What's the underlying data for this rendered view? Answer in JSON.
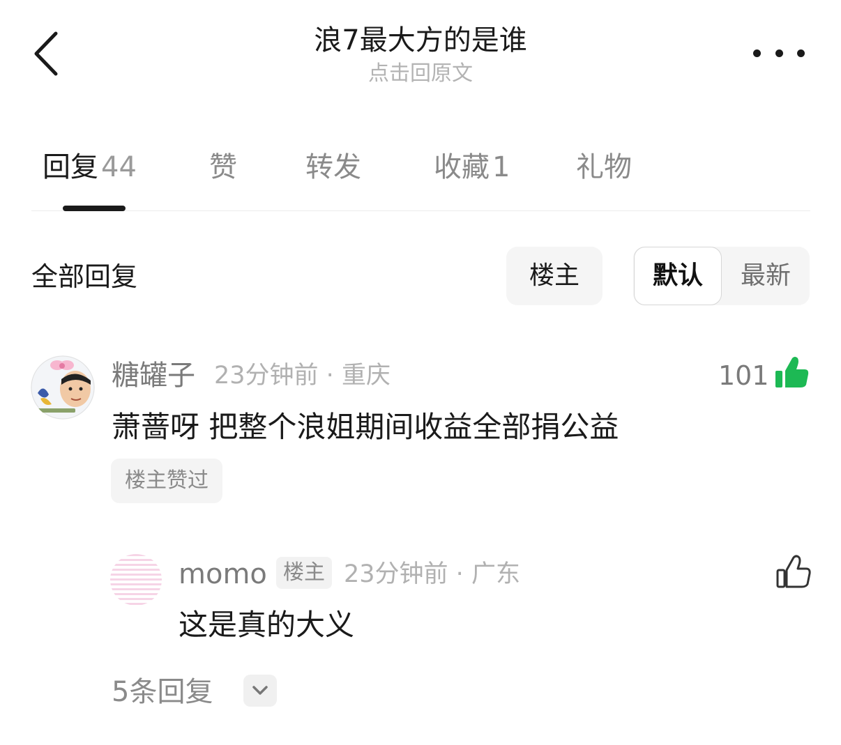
{
  "header": {
    "title": "浪7最大方的是谁",
    "subtitle": "点击回原文",
    "back_icon": "chevron-left-icon",
    "more_icon": "more-horizontal-icon"
  },
  "tabs": [
    {
      "label": "回复",
      "count": "44"
    },
    {
      "label": "赞",
      "count": ""
    },
    {
      "label": "转发",
      "count": ""
    },
    {
      "label": "收藏",
      "count": "1"
    },
    {
      "label": "礼物",
      "count": ""
    }
  ],
  "filter": {
    "all_replies_label": "全部回复",
    "op_only_label": "楼主",
    "sort_default_label": "默认",
    "sort_latest_label": "最新"
  },
  "comments": [
    {
      "username": "糖罐子",
      "time": "23分钟前",
      "location": "重庆",
      "like_count": "101",
      "liked": true,
      "content": "萧蔷呀 把整个浪姐期间收益全部捐公益",
      "op_liked_label": "楼主赞过"
    },
    {
      "username": "momo",
      "op_badge": "楼主",
      "time": "23分钟前",
      "location": "广东",
      "content": "这是真的大义"
    }
  ],
  "more_replies_label": "5条回复",
  "colors": {
    "like_active": "#1db954",
    "text_primary": "#1a1a1a",
    "text_secondary": "#8a8a8a"
  }
}
